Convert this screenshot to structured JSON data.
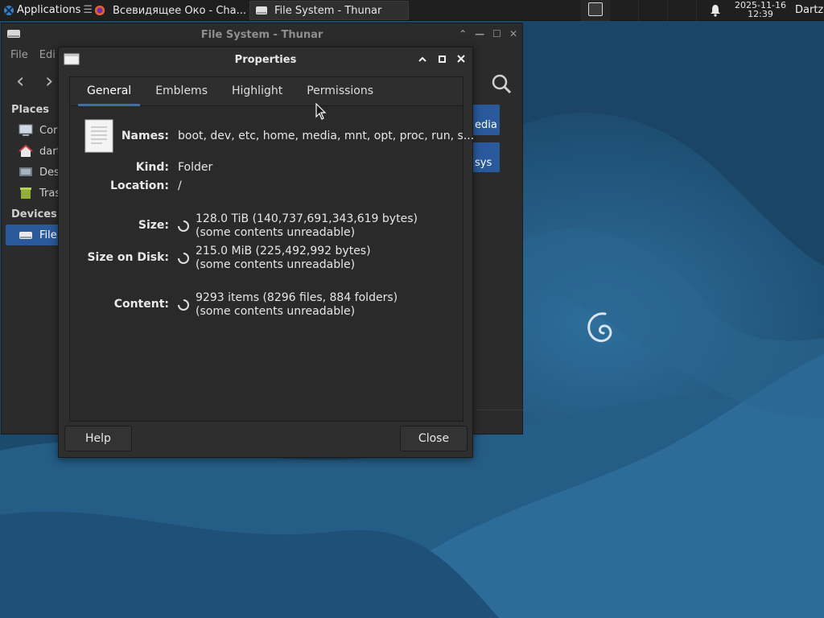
{
  "panel": {
    "apps_label": "Applications",
    "tasks": [
      {
        "label": "Всевидящее Око - Cha..."
      },
      {
        "label": "File System - Thunar"
      }
    ],
    "clock_date": "2025-11-16",
    "clock_time": "12:39",
    "user": "Dartz"
  },
  "thunar": {
    "title": "File System - Thunar",
    "menu": [
      "File",
      "Edi"
    ],
    "places_header": "Places",
    "devices_header": "Devices",
    "places": [
      "Cor",
      "dart",
      "Des",
      "Tras"
    ],
    "devices": [
      "File"
    ],
    "content_items": [
      "edia",
      "sys"
    ]
  },
  "dialog": {
    "title": "Properties",
    "tabs": [
      "General",
      "Emblems",
      "Highlight",
      "Permissions"
    ],
    "active_tab": "General",
    "names_label": "Names:",
    "names_value": "boot, dev, etc, home, media, mnt, opt, proc, run, s...",
    "kind_label": "Kind:",
    "kind_value": "Folder",
    "location_label": "Location:",
    "location_value": "/",
    "size_label": "Size:",
    "size_value": "128.0 TiB (140,737,691,343,619 bytes)",
    "size_note": "(some contents unreadable)",
    "disk_label": "Size on Disk:",
    "disk_value": "215.0 MiB (225,492,992 bytes)",
    "disk_note": "(some contents unreadable)",
    "content_label": "Content:",
    "content_value": "9293 items (8296 files, 884 folders)",
    "content_note": "(some contents unreadable)",
    "help_button": "Help",
    "close_button": "Close"
  },
  "colors": {
    "wallpaper_dark": "#1b4768",
    "wallpaper_light": "#2c6c98",
    "selection": "#2a5a9c",
    "tab_indicator": "#3f6ea8",
    "window_bg": "#2e2e2e"
  }
}
